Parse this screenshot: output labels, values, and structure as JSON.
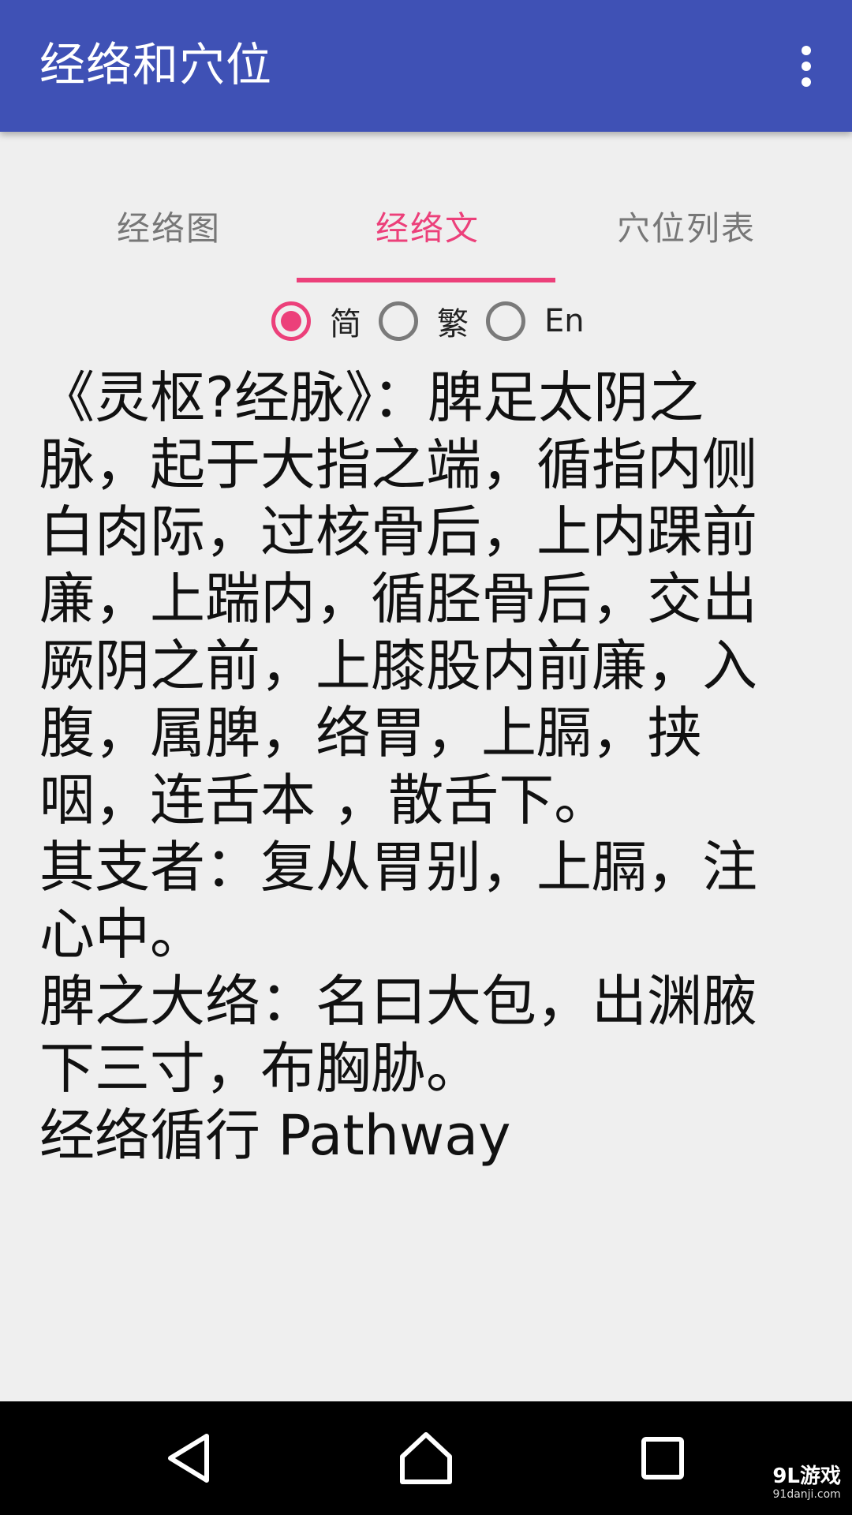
{
  "app_bar": {
    "title": "经络和穴位",
    "menu_icon": "more-vertical-icon"
  },
  "tabs": [
    {
      "label": "经络图",
      "active": false
    },
    {
      "label": "经络文",
      "active": true
    },
    {
      "label": "穴位列表",
      "active": false
    }
  ],
  "language_options": [
    {
      "label": "简",
      "selected": true
    },
    {
      "label": "繁",
      "selected": false
    },
    {
      "label": "En",
      "selected": false
    }
  ],
  "content": {
    "paragraphs": [
      "《灵枢?经脉》：脾足太阴之脉，起于大指之端，循指内侧白肉际，过核骨后，上内踝前廉，上踹内，循胫骨后，交出厥阴之前，上膝股内前廉，入腹，属脾，络胃，上膈，挟咽，连舌本 ，散舌下。",
      "其支者：复从胃别，上膈，注心中。",
      "脾之大络：名曰大包，出渊腋下三寸，布胸胁。",
      "经络循行 Pathway"
    ]
  },
  "nav_bar": {
    "back_icon": "back-triangle-icon",
    "home_icon": "home-icon",
    "recent_icon": "recent-apps-icon"
  },
  "watermark": {
    "main": "9L游戏",
    "sub": "91danji.com"
  },
  "colors": {
    "primary": "#3f51b5",
    "accent": "#ec407a",
    "background": "#efefef"
  }
}
